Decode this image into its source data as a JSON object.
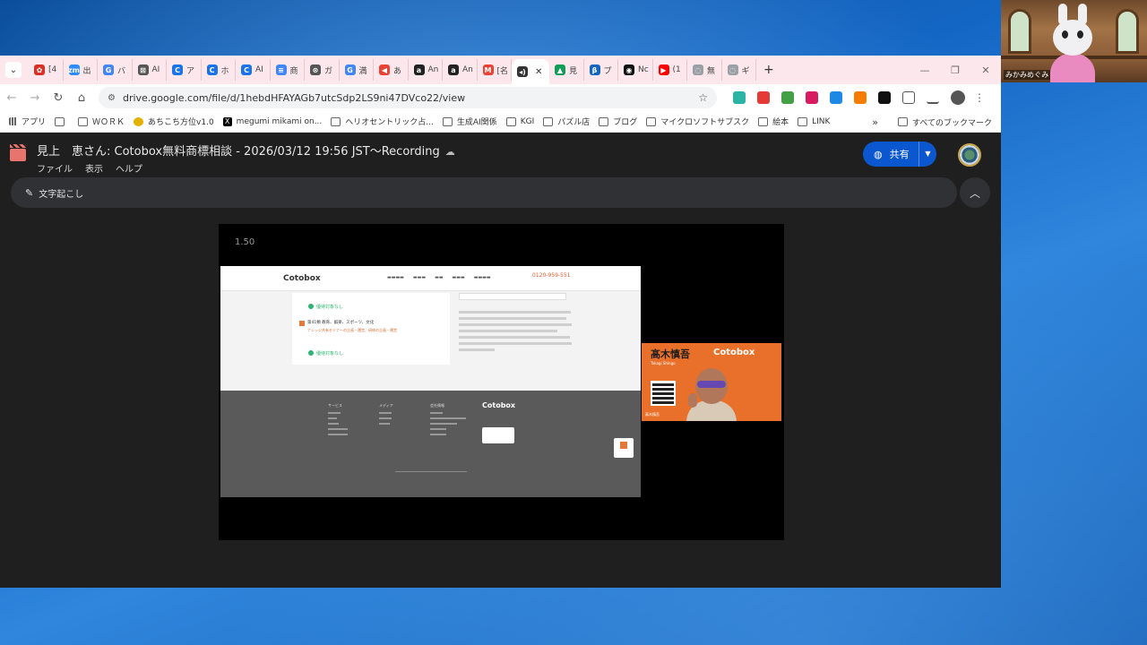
{
  "tabs": [
    {
      "label": "[4",
      "color": "#d93025",
      "glyph": "✿"
    },
    {
      "label": "出",
      "color": "#2d8cff",
      "glyph": "zm"
    },
    {
      "label": "バ",
      "color": "#4285f4",
      "glyph": "G"
    },
    {
      "label": "AI",
      "color": "#555555",
      "glyph": "⊠"
    },
    {
      "label": "ア",
      "color": "#1a73e8",
      "glyph": "C"
    },
    {
      "label": "ホ",
      "color": "#1a73e8",
      "glyph": "C"
    },
    {
      "label": "AI",
      "color": "#1a73e8",
      "glyph": "C"
    },
    {
      "label": "商",
      "color": "#4285f4",
      "glyph": "≡"
    },
    {
      "label": "ガ",
      "color": "#555555",
      "glyph": "⊛"
    },
    {
      "label": "満",
      "color": "#4285f4",
      "glyph": "G"
    },
    {
      "label": "あ",
      "color": "#ea4335",
      "glyph": "◀"
    },
    {
      "label": "An",
      "color": "#222222",
      "glyph": "a"
    },
    {
      "label": "An",
      "color": "#222222",
      "glyph": "a"
    },
    {
      "label": "[名",
      "color": "#ea4335",
      "glyph": "M"
    },
    {
      "label": "",
      "color": "#333333",
      "glyph": "◂)",
      "active": true
    },
    {
      "label": "見",
      "color": "#0f9d58",
      "glyph": "▲"
    },
    {
      "label": "プ",
      "color": "#1565c0",
      "glyph": "β"
    },
    {
      "label": "Nc",
      "color": "#111111",
      "glyph": "◉"
    },
    {
      "label": "(1",
      "color": "#ff0000",
      "glyph": "▶"
    },
    {
      "label": "無",
      "color": "#9aa0a6",
      "glyph": "◌"
    },
    {
      "label": "ギ",
      "color": "#9aa0a6",
      "glyph": "◌"
    }
  ],
  "toolbar": {
    "url": "drive.google.com/file/d/1hebdHFAYAGb7utcSdp2LS9ni47DVco22/view"
  },
  "bookmarks": {
    "items": [
      "アプリ",
      "",
      "ＷＯＲＫ",
      "あちこち方位v1.0",
      "megumi mikami on...",
      "ヘリオセントリック占...",
      "生成AI関係",
      "KGI",
      "パズル店",
      "ブログ",
      "マイクロソフトサブスク",
      "絵本",
      "LINK"
    ],
    "overflow": "»",
    "all_bookmarks": "すべてのブックマーク"
  },
  "drive": {
    "title": "見上　恵さん: Cotobox無料商標相談 - 2026/03/12 19:56 JST〜Recording",
    "menu": [
      "ファイル",
      "表示",
      "ヘルプ"
    ],
    "share_label": "共有"
  },
  "transcript": {
    "label": "文字起こし"
  },
  "player": {
    "speed": "1.50",
    "site_logo": "Cotobox",
    "site_phone": "0120-959-551",
    "green_label_1": "優待対象なし",
    "card_heading": "第41類 教育、娯楽、スポーツ、文化",
    "card_body": "ナレッジ共有セミナーの企画・運営、研修の企画・運営",
    "green_label_2": "優待対象なし",
    "footer_logo": "Cotobox",
    "footer_cols": [
      "サービス",
      "メディア",
      "会社情報"
    ],
    "speaker_name": "髙木慎吾",
    "speaker_logo": "Cotobox",
    "speaker_romaji": "Takagi Shingo",
    "speaker_caption": "高木慎吾"
  },
  "overlay": {
    "name": "みかみめぐみ"
  }
}
